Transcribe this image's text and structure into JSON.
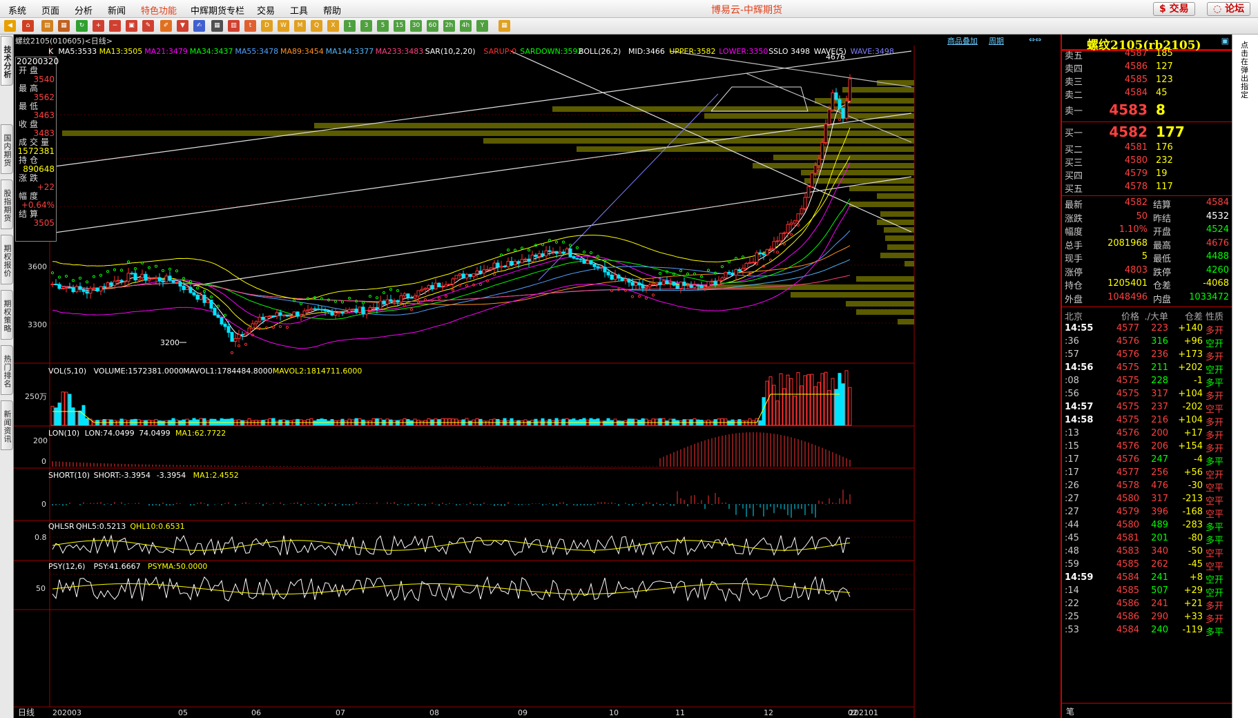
{
  "menubar": {
    "items": [
      "系统",
      "页面",
      "分析",
      "新闻",
      "特色功能",
      "中辉期货专栏",
      "交易",
      "工具",
      "帮助"
    ],
    "title": "博易云-中辉期货",
    "trade_button": "交易",
    "forum_button": "论坛"
  },
  "toolbar": {
    "buttons": [
      "1",
      "3",
      "5",
      "15",
      "30",
      "60",
      "2h",
      "4h",
      "Y"
    ]
  },
  "left_tabs": [
    "技术分析",
    "国内期货",
    "股指期货",
    "期权报价",
    "期权策略",
    "热门排名",
    "新闻资讯"
  ],
  "header": {
    "instrument": "螺纹2105(010605)<日线>",
    "link_overlay": "商品叠加",
    "link_period": "周期"
  },
  "indicators": {
    "main": [
      {
        "text": "K",
        "color": "#ffffff"
      },
      {
        "text": "MA5:3533",
        "color": "#ffffff"
      },
      {
        "text": "MA13:3505",
        "color": "#ffff00"
      },
      {
        "text": "MA21:3479",
        "color": "#ff00ff"
      },
      {
        "text": "MA34:3437",
        "color": "#00ff00"
      },
      {
        "text": "MA55:3478",
        "color": "#4fa3ff"
      },
      {
        "text": "MA89:3454",
        "color": "#ff9020"
      },
      {
        "text": "MA144:3377",
        "color": "#4fb8ff"
      },
      {
        "text": "MA233:3483",
        "color": "#ff4080"
      },
      {
        "text": "SAR(10,2,20)",
        "color": "#ffffff"
      },
      {
        "text": "SARUP:0",
        "color": "#ff3030"
      },
      {
        "text": "SARDOWN:3592",
        "color": "#00ff00"
      },
      {
        "text": "BOLL(26,2)",
        "color": "#ffffff"
      },
      {
        "text": "MID:3466",
        "color": "#ffffff"
      },
      {
        "text": "UPPER:3582",
        "color": "#ffff00"
      },
      {
        "text": "LOWER:3350",
        "color": "#ff00ff"
      },
      {
        "text": "SSLO 3498",
        "color": "#ffffff"
      },
      {
        "text": "WAVE(5)",
        "color": "#ffffff"
      },
      {
        "text": "WAVE:3498",
        "color": "#8080ff"
      }
    ],
    "vol": [
      {
        "text": "VOL(5,10)",
        "color": "#ffffff"
      },
      {
        "text": "VOLUME:1572381.0000",
        "color": "#ffffff"
      },
      {
        "text": "MAVOL1:1784484.8000",
        "color": "#ffffff"
      },
      {
        "text": "MAVOL2:1814711.6000",
        "color": "#ffff00"
      }
    ],
    "lon": [
      {
        "text": "LON(10)",
        "color": "#ffffff"
      },
      {
        "text": "LON:74.0499",
        "color": "#ffffff"
      },
      {
        "text": "74.0499",
        "color": "#ffffff"
      },
      {
        "text": "MA1:62.7722",
        "color": "#ffff00"
      }
    ],
    "short": [
      {
        "text": "SHORT(10)",
        "color": "#ffffff"
      },
      {
        "text": "SHORT:-3.3954",
        "color": "#ffffff"
      },
      {
        "text": "-3.3954",
        "color": "#ffffff"
      },
      {
        "text": "MA1:2.4552",
        "color": "#ffff00"
      }
    ],
    "qhlsr": [
      {
        "text": "QHLSR",
        "color": "#ffffff"
      },
      {
        "text": "QHL5:0.5213",
        "color": "#ffffff"
      },
      {
        "text": "QHL10:0.6531",
        "color": "#ffff00"
      }
    ],
    "psy": [
      {
        "text": "PSY(12,6)",
        "color": "#ffffff"
      },
      {
        "text": "PSY:41.6667",
        "color": "#ffffff"
      },
      {
        "text": "PSYMA:50.0000",
        "color": "#ffff00"
      }
    ]
  },
  "axes": {
    "price_labels": [
      "3600",
      "3300"
    ],
    "vol_label": "250万",
    "lon_labels": [
      "200",
      "0"
    ],
    "short_label": "0",
    "qhlsr_label": "0.8",
    "psy_label": "50",
    "period_label": "日线",
    "x_labels": [
      "202003",
      "05",
      "06",
      "07",
      "08",
      "09",
      "10",
      "11",
      "12",
      "202101",
      "02"
    ]
  },
  "annotations": {
    "low_marker": "3200",
    "high_marker": "4676"
  },
  "infobox": {
    "date": "20200320",
    "rows": [
      {
        "label": "开盘",
        "value": "3540",
        "color": "#ff4040"
      },
      {
        "label": "最高",
        "value": "3562",
        "color": "#ff4040"
      },
      {
        "label": "最低",
        "value": "3463",
        "color": "#ff4040"
      },
      {
        "label": "收盘",
        "value": "3483",
        "color": "#ff4040"
      },
      {
        "label": "成交量",
        "value": "1572381",
        "color": "#ffff00"
      },
      {
        "label": "持仓",
        "value": "890648",
        "color": "#ffff00"
      },
      {
        "label": "涨跌",
        "value": "+22",
        "color": "#ff4040"
      },
      {
        "label": "幅度",
        "value": "+0.64%",
        "color": "#ff4040"
      },
      {
        "label": "结算",
        "value": "3505",
        "color": "#ff4040"
      }
    ]
  },
  "orderbook": {
    "title": "螺纹2105(rb2105)",
    "asks": [
      {
        "label": "卖五",
        "price": "4587",
        "vol": "185"
      },
      {
        "label": "卖四",
        "price": "4586",
        "vol": "127"
      },
      {
        "label": "卖三",
        "price": "4585",
        "vol": "123"
      },
      {
        "label": "卖二",
        "price": "4584",
        "vol": "45"
      },
      {
        "label": "卖一",
        "price": "4583",
        "vol": "8"
      }
    ],
    "bids": [
      {
        "label": "买一",
        "price": "4582",
        "vol": "177"
      },
      {
        "label": "买二",
        "price": "4581",
        "vol": "176"
      },
      {
        "label": "买三",
        "price": "4580",
        "vol": "232"
      },
      {
        "label": "买四",
        "price": "4579",
        "vol": "19"
      },
      {
        "label": "买五",
        "price": "4578",
        "vol": "117"
      }
    ]
  },
  "quote": [
    {
      "l1": "最新",
      "v1": "4582",
      "c1": "#ff4040",
      "l2": "结算",
      "v2": "4584",
      "c2": "#ff4040"
    },
    {
      "l1": "涨跌",
      "v1": "50",
      "c1": "#ff4040",
      "l2": "昨结",
      "v2": "4532",
      "c2": "#ffffff"
    },
    {
      "l1": "幅度",
      "v1": "1.10%",
      "c1": "#ff4040",
      "l2": "开盘",
      "v2": "4524",
      "c2": "#00ff00"
    },
    {
      "l1": "总手",
      "v1": "2081968",
      "c1": "#ffff00",
      "l2": "最高",
      "v2": "4676",
      "c2": "#ff4040"
    },
    {
      "l1": "现手",
      "v1": "5",
      "c1": "#ffff00",
      "l2": "最低",
      "v2": "4488",
      "c2": "#00ff00"
    },
    {
      "l1": "涨停",
      "v1": "4803",
      "c1": "#ff4040",
      "l2": "跌停",
      "v2": "4260",
      "c2": "#00ff00"
    },
    {
      "l1": "持仓",
      "v1": "1205401",
      "c1": "#ffff00",
      "l2": "仓差",
      "v2": "-4068",
      "c2": "#ffff00"
    },
    {
      "l1": "外盘",
      "v1": "1048496",
      "c1": "#ff4040",
      "l2": "内盘",
      "v2": "1033472",
      "c2": "#00ff00"
    }
  ],
  "trades_header": {
    "loc": "北京",
    "price": "价格",
    "vol": "./大单",
    "chg": "仓差",
    "type": "性质"
  },
  "trades": [
    {
      "time": "14:55",
      "major": true,
      "price": "4577",
      "vol": "223",
      "chg": "+140",
      "type": "多开",
      "vc": "#ff4040",
      "cc": "#ffff00",
      "tc": "#ff4040"
    },
    {
      "time": ":36",
      "major": false,
      "price": "4576",
      "vol": "316",
      "chg": "+96",
      "type": "空开",
      "vc": "#00ff00",
      "cc": "#ffff00",
      "tc": "#00ff00"
    },
    {
      "time": ":57",
      "major": false,
      "price": "4576",
      "vol": "236",
      "chg": "+173",
      "type": "多开",
      "vc": "#ff4040",
      "cc": "#ffff00",
      "tc": "#ff4040"
    },
    {
      "time": "14:56",
      "major": true,
      "price": "4575",
      "vol": "211",
      "chg": "+202",
      "type": "空开",
      "vc": "#00ff00",
      "cc": "#ffff00",
      "tc": "#00ff00"
    },
    {
      "time": ":08",
      "major": false,
      "price": "4575",
      "vol": "228",
      "chg": "-1",
      "type": "多平",
      "vc": "#00ff00",
      "cc": "#ffff00",
      "tc": "#00ff00"
    },
    {
      "time": ":56",
      "major": false,
      "price": "4575",
      "vol": "317",
      "chg": "+104",
      "type": "多开",
      "vc": "#ff4040",
      "cc": "#ffff00",
      "tc": "#ff4040"
    },
    {
      "time": "14:57",
      "major": true,
      "price": "4575",
      "vol": "237",
      "chg": "-202",
      "type": "空平",
      "vc": "#ff4040",
      "cc": "#ffff00",
      "tc": "#ff4040"
    },
    {
      "time": "14:58",
      "major": true,
      "price": "4575",
      "vol": "216",
      "chg": "+104",
      "type": "多开",
      "vc": "#ff4040",
      "cc": "#ffff00",
      "tc": "#ff4040"
    },
    {
      "time": ":13",
      "major": false,
      "price": "4576",
      "vol": "200",
      "chg": "+17",
      "type": "多开",
      "vc": "#ff4040",
      "cc": "#ffff00",
      "tc": "#ff4040"
    },
    {
      "time": ":15",
      "major": false,
      "price": "4576",
      "vol": "206",
      "chg": "+154",
      "type": "多开",
      "vc": "#ff4040",
      "cc": "#ffff00",
      "tc": "#ff4040"
    },
    {
      "time": ":17",
      "major": false,
      "price": "4576",
      "vol": "247",
      "chg": "-4",
      "type": "多平",
      "vc": "#00ff00",
      "cc": "#ffff00",
      "tc": "#00ff00"
    },
    {
      "time": ":17",
      "major": false,
      "price": "4577",
      "vol": "256",
      "chg": "+56",
      "type": "空开",
      "vc": "#ff4040",
      "cc": "#ffff00",
      "tc": "#ff4040"
    },
    {
      "time": ":26",
      "major": false,
      "price": "4578",
      "vol": "476",
      "chg": "-30",
      "type": "空平",
      "vc": "#ff4040",
      "cc": "#ffff00",
      "tc": "#ff4040"
    },
    {
      "time": ":27",
      "major": false,
      "price": "4580",
      "vol": "317",
      "chg": "-213",
      "type": "空平",
      "vc": "#ff4040",
      "cc": "#ffff00",
      "tc": "#ff4040"
    },
    {
      "time": ":27",
      "major": false,
      "price": "4579",
      "vol": "396",
      "chg": "-168",
      "type": "空平",
      "vc": "#ff4040",
      "cc": "#ffff00",
      "tc": "#ff4040"
    },
    {
      "time": ":44",
      "major": false,
      "price": "4580",
      "vol": "489",
      "chg": "-283",
      "type": "多平",
      "vc": "#00ff00",
      "cc": "#ffff00",
      "tc": "#00ff00"
    },
    {
      "time": ":45",
      "major": false,
      "price": "4581",
      "vol": "201",
      "chg": "-80",
      "type": "多平",
      "vc": "#00ff00",
      "cc": "#ffff00",
      "tc": "#00ff00"
    },
    {
      "time": ":48",
      "major": false,
      "price": "4583",
      "vol": "340",
      "chg": "-50",
      "type": "空平",
      "vc": "#ff4040",
      "cc": "#ffff00",
      "tc": "#ff4040"
    },
    {
      "time": ":59",
      "major": false,
      "price": "4585",
      "vol": "262",
      "chg": "-45",
      "type": "空平",
      "vc": "#ff4040",
      "cc": "#ffff00",
      "tc": "#ff4040"
    },
    {
      "time": "14:59",
      "major": true,
      "price": "4584",
      "vol": "241",
      "chg": "+8",
      "type": "空开",
      "vc": "#00ff00",
      "cc": "#ffff00",
      "tc": "#00ff00"
    },
    {
      "time": ":14",
      "major": false,
      "price": "4585",
      "vol": "507",
      "chg": "+29",
      "type": "空开",
      "vc": "#00ff00",
      "cc": "#ffff00",
      "tc": "#00ff00"
    },
    {
      "time": ":22",
      "major": false,
      "price": "4586",
      "vol": "241",
      "chg": "+21",
      "type": "多开",
      "vc": "#ff4040",
      "cc": "#ffff00",
      "tc": "#ff4040"
    },
    {
      "time": ":25",
      "major": false,
      "price": "4586",
      "vol": "290",
      "chg": "+33",
      "type": "多开",
      "vc": "#ff4040",
      "cc": "#ffff00",
      "tc": "#ff4040"
    },
    {
      "time": ":53",
      "major": false,
      "price": "4584",
      "vol": "240",
      "chg": "-119",
      "type": "多平",
      "vc": "#00ff00",
      "cc": "#ffff00",
      "tc": "#00ff00"
    }
  ],
  "bottom_tab": "笔",
  "right_side_text": "点击在弹出指定"
}
